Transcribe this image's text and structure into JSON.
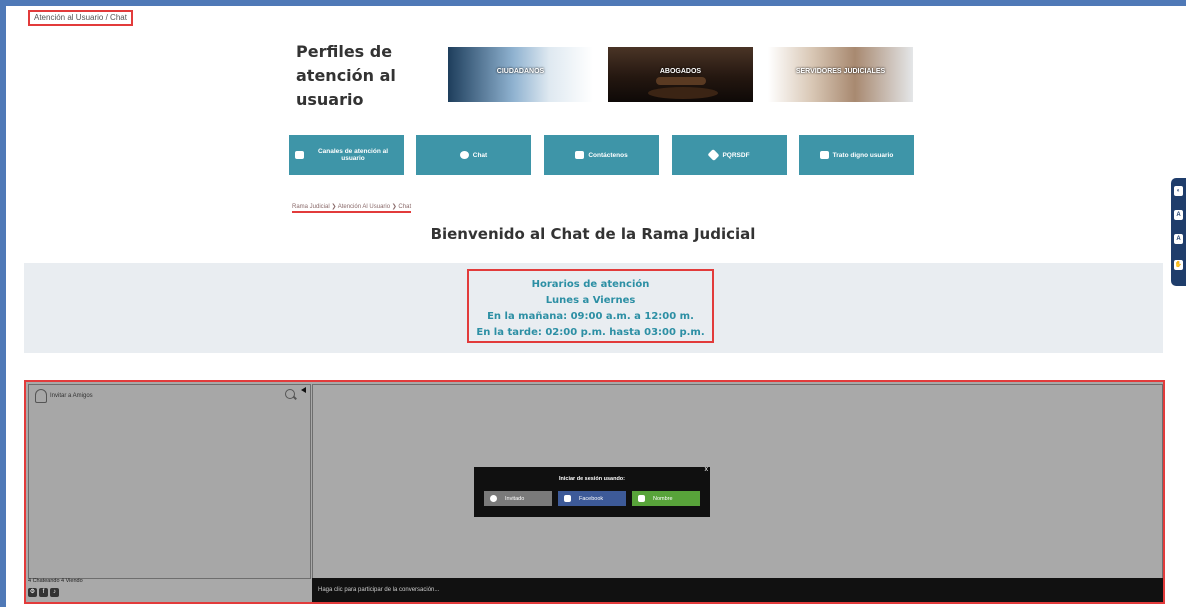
{
  "breadcrumb_top": "Atención al Usuario / Chat",
  "page_title": "Perfiles de atención al usuario",
  "profiles": [
    {
      "label": "CIUDADANOS"
    },
    {
      "label": "ABOGADOS"
    },
    {
      "label": "SERVIDORES JUDICIALES"
    }
  ],
  "nav_buttons": [
    {
      "label": "Canales de atención al usuario",
      "icon": "channels-icon"
    },
    {
      "label": "Chat",
      "icon": "chat-icon"
    },
    {
      "label": "Contáctenos",
      "icon": "mail-icon"
    },
    {
      "label": "PQRSDF",
      "icon": "paperclip-icon"
    },
    {
      "label": "Trato digno usuario",
      "icon": "people-icon"
    }
  ],
  "breadcrumb": "Rama Judicial  ❯  Atención Al Usuario  ❯  Chat",
  "welcome": "Bienvenido al Chat de la Rama Judicial",
  "hours": {
    "title": "Horarios de atención",
    "days": "Lunes a Viernes",
    "morning": "En la mañana: 09:00 a.m. a 12:00 m.",
    "afternoon": "En la tarde: 02:00 p.m. hasta 03:00 p.m."
  },
  "chat": {
    "invite_label": "Invitar a Amigos",
    "stats": "4 Chateando 4 Viendo",
    "input_placeholder": "Haga clic para participar de la conversación...",
    "login_title": "Iniciar de sesión usando:",
    "login_options": [
      {
        "label": "Invitado",
        "icon": "chat-bubble-icon"
      },
      {
        "label": "Facebook",
        "icon": "facebook-icon"
      },
      {
        "label": "Nombre",
        "icon": "user-icon"
      }
    ],
    "close": "x"
  },
  "accessibility_tools": [
    "A",
    "A",
    "A"
  ],
  "colors": {
    "frame": "#4f79b7",
    "nav_button": "#3e95a8",
    "hours_text": "#2c8fa4",
    "highlight": "#e23b3b",
    "facebook": "#3d5a98",
    "name_button": "#58a33a"
  }
}
